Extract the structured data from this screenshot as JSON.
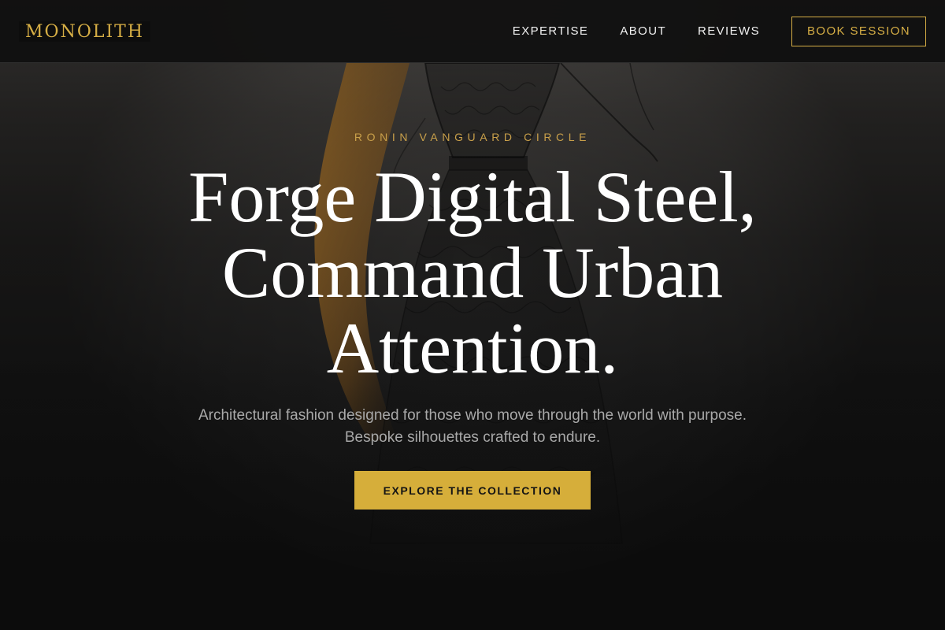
{
  "header": {
    "logo": "MONOLITH",
    "nav": [
      "EXPERTISE",
      "ABOUT",
      "REVIEWS"
    ],
    "cta": "BOOK SESSION"
  },
  "hero": {
    "eyebrow": "RONIN VANGUARD CIRCLE",
    "headline_lines": [
      "Forge Digital Steel,",
      "Command Urban",
      "Attention."
    ],
    "subtext": "Architectural fashion designed for those who move through the world with purpose. Bespoke silhouettes crafted to endure.",
    "cta": "EXPLORE THE COLLECTION",
    "background_image": "fashion-sketch-dress-illustration"
  },
  "colors": {
    "accent": "#d6ae3a",
    "header_bg": "#0f0f0f",
    "headline": "#ffffff",
    "subtext": "#a9a9a9"
  }
}
